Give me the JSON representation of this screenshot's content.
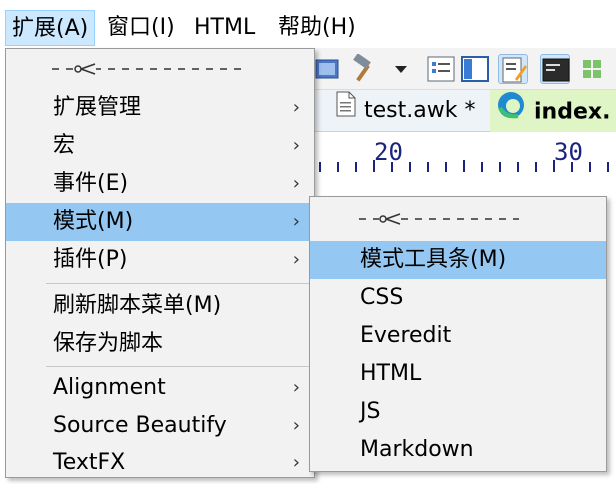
{
  "menubar": {
    "items": [
      {
        "label": "扩展(A)"
      },
      {
        "label": "窗口(I)"
      },
      {
        "label": "HTML"
      },
      {
        "label": "帮助(H)"
      }
    ]
  },
  "tabs": [
    {
      "label": "test.awk *"
    },
    {
      "label": "index."
    }
  ],
  "ruler": {
    "marks": [
      "20",
      "30"
    ]
  },
  "extension_menu": {
    "items": [
      {
        "label": "扩展管理",
        "submenu": true
      },
      {
        "label": "宏",
        "submenu": true
      },
      {
        "label": "事件(E)",
        "submenu": true
      },
      {
        "label": "模式(M)",
        "submenu": true,
        "highlighted": true
      },
      {
        "label": "插件(P)",
        "submenu": true
      },
      {
        "label": "刷新脚本菜单(M)"
      },
      {
        "label": "保存为脚本"
      },
      {
        "label": "Alignment",
        "submenu": true
      },
      {
        "label": "Source Beautify",
        "submenu": true
      },
      {
        "label": "TextFX",
        "submenu": true
      }
    ]
  },
  "mode_submenu": {
    "items": [
      {
        "label": "模式工具条(M)",
        "highlighted": true
      },
      {
        "label": "CSS"
      },
      {
        "label": "Everedit"
      },
      {
        "label": "HTML"
      },
      {
        "label": "JS"
      },
      {
        "label": "Markdown"
      }
    ]
  },
  "icons": {
    "submenu_arrow": "chevron-right-icon",
    "tearoff": "scissors-icon",
    "file": "document-icon",
    "browser": "edge-browser-icon"
  },
  "colors": {
    "menu_bg": "#f2f2f2",
    "highlight": "#94c8f3",
    "menubar_active": "#cce8ff",
    "active_tab": "#dff5c6"
  }
}
